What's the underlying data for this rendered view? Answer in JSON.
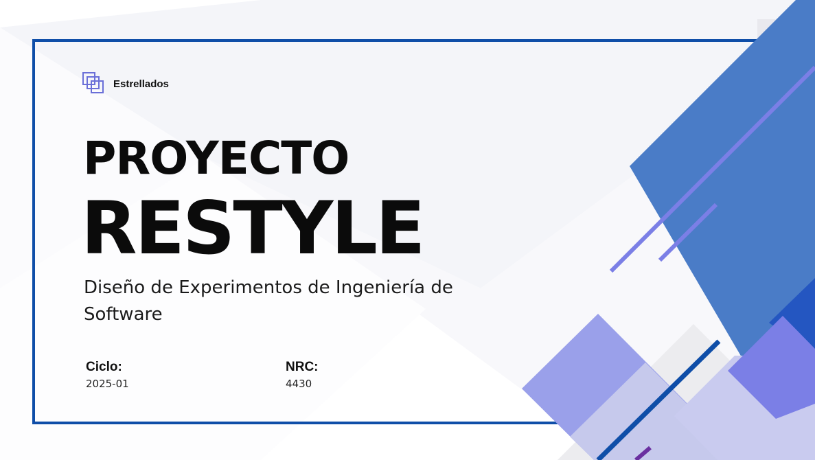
{
  "brand": {
    "name": "Estrellados",
    "logo_icon": "stacked-squares-icon"
  },
  "title": {
    "line1": "PROYECTO",
    "line2": "RESTYLE"
  },
  "subtitle": "Diseño de Experimentos de Ingeniería de Software",
  "info": {
    "cycle_label": "Ciclo:",
    "cycle_value": "2025-01",
    "nrc_label": "NRC:",
    "nrc_value": "4430"
  },
  "colors": {
    "frame": "#0f4ea8",
    "blue_main": "#4a7cc7",
    "blue_deep": "#2456c1",
    "violet": "#7b7fe6",
    "lavender": "#c9cbef",
    "purple_accent": "#6a2fa0"
  }
}
